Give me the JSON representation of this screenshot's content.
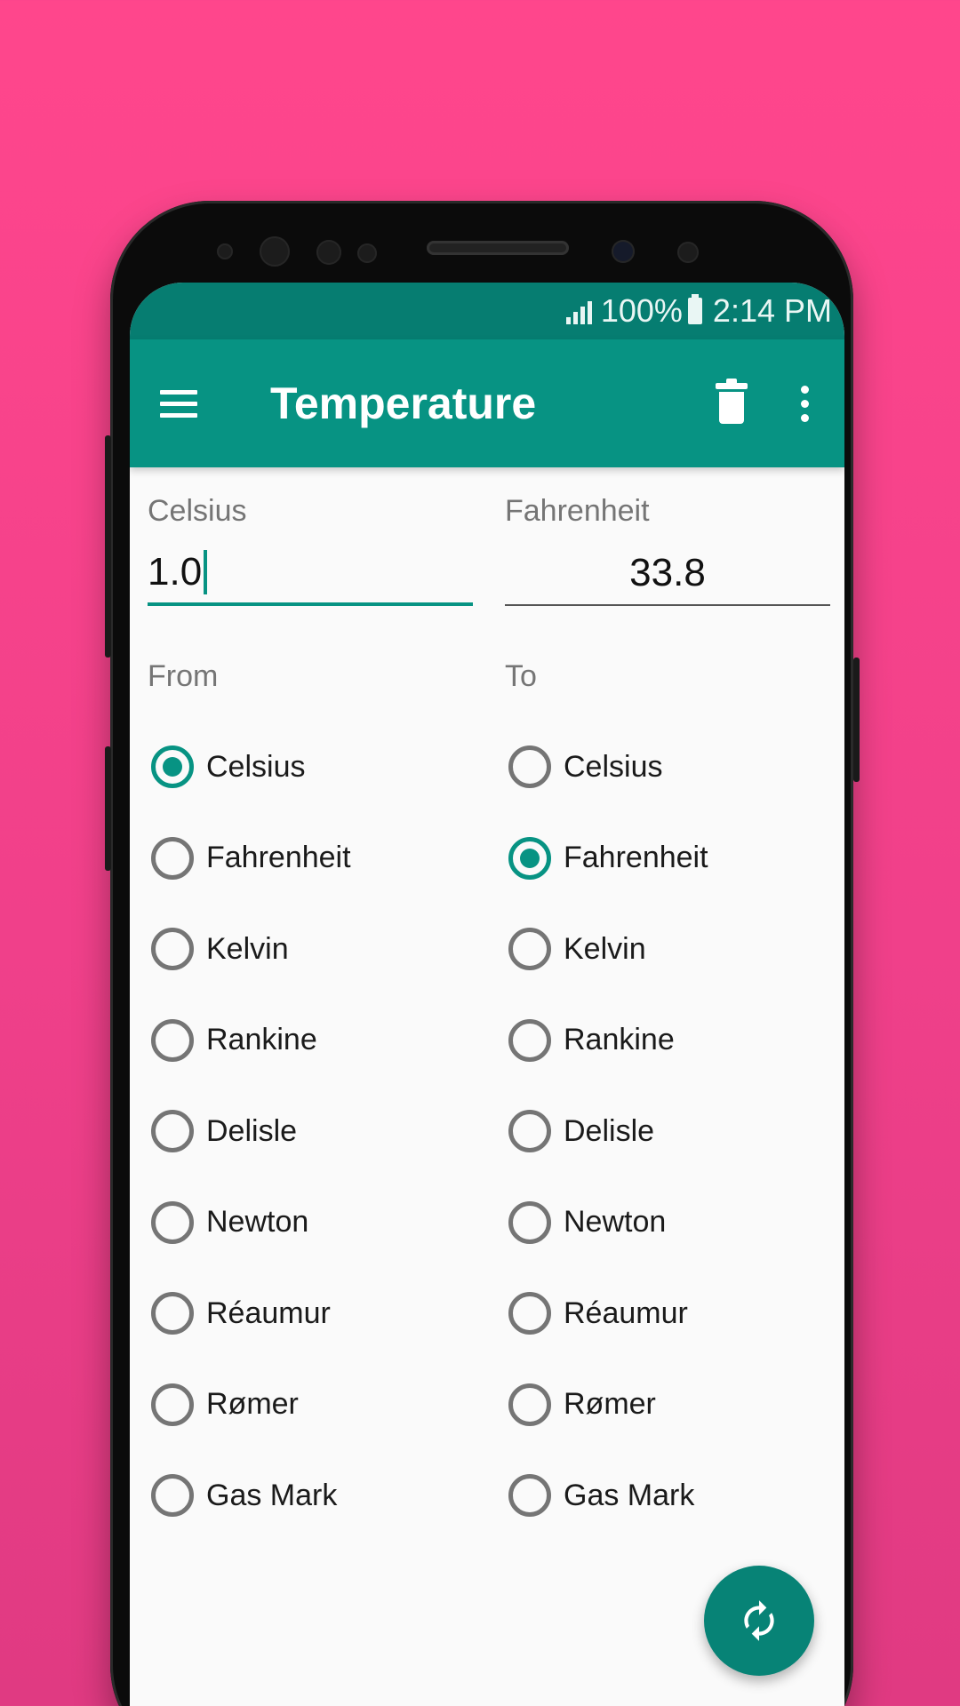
{
  "status_bar": {
    "battery": "100%",
    "time": "2:14 PM"
  },
  "app_bar": {
    "title": "Temperature",
    "icons": [
      "menu-icon",
      "trash-icon",
      "more-vert-icon"
    ]
  },
  "input": {
    "label": "Celsius",
    "value": "1.0"
  },
  "output": {
    "label": "Fahrenheit",
    "value": "33.8"
  },
  "from": {
    "label": "From",
    "selected": "Celsius",
    "options": [
      "Celsius",
      "Fahrenheit",
      "Kelvin",
      "Rankine",
      "Delisle",
      "Newton",
      "Réaumur",
      "Rømer",
      "Gas Mark"
    ]
  },
  "to": {
    "label": "To",
    "selected": "Fahrenheit",
    "options": [
      "Celsius",
      "Fahrenheit",
      "Kelvin",
      "Rankine",
      "Delisle",
      "Newton",
      "Réaumur",
      "Rømer",
      "Gas Mark"
    ]
  },
  "fab": {
    "icon": "swap-refresh-icon"
  },
  "colors": {
    "primary": "#079383",
    "primary_dark": "#067d71",
    "background": "#ff468c"
  }
}
